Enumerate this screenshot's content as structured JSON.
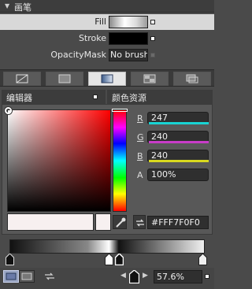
{
  "section": {
    "title": "画笔",
    "collapse_glyph": "▼"
  },
  "properties": [
    {
      "label": "Fill",
      "value_kind": "gradient-swatch",
      "selected": true
    },
    {
      "label": "Stroke",
      "value_kind": "color-swatch",
      "color": "#000000"
    },
    {
      "label": "OpacityMask",
      "value": "No brush"
    }
  ],
  "brush_tabs": [
    {
      "name": "no-brush",
      "icon": "no-brush-icon",
      "active": false
    },
    {
      "name": "solid-color",
      "icon": "solid-color-brush-icon",
      "active": false
    },
    {
      "name": "gradient",
      "icon": "gradient-brush-icon",
      "active": true
    },
    {
      "name": "tile",
      "icon": "tile-brush-icon",
      "active": false
    },
    {
      "name": "resource",
      "icon": "brush-resource-icon",
      "active": false
    }
  ],
  "editor_tabs": {
    "editor": "编辑器",
    "color_resources": "颜色资源"
  },
  "color": {
    "r_label": "R",
    "r": "247",
    "g_label": "G",
    "g": "240",
    "b_label": "B",
    "b": "240",
    "a_label": "A",
    "a": "100%",
    "hex": "#FFF7F0F0",
    "current": "#f7f0f0",
    "r_color": "#19d3d3",
    "g_color": "#c83cc8",
    "b_color": "#d8d81e"
  },
  "gradient": {
    "stops": [
      {
        "offset": 0.0,
        "color": "#111111"
      },
      {
        "offset": 0.51,
        "color": "#ffffff"
      },
      {
        "offset": 0.56,
        "color": "#111111"
      },
      {
        "offset": 1.0,
        "color": "#f0f0f0"
      }
    ],
    "selected_offset": "57.6%"
  }
}
